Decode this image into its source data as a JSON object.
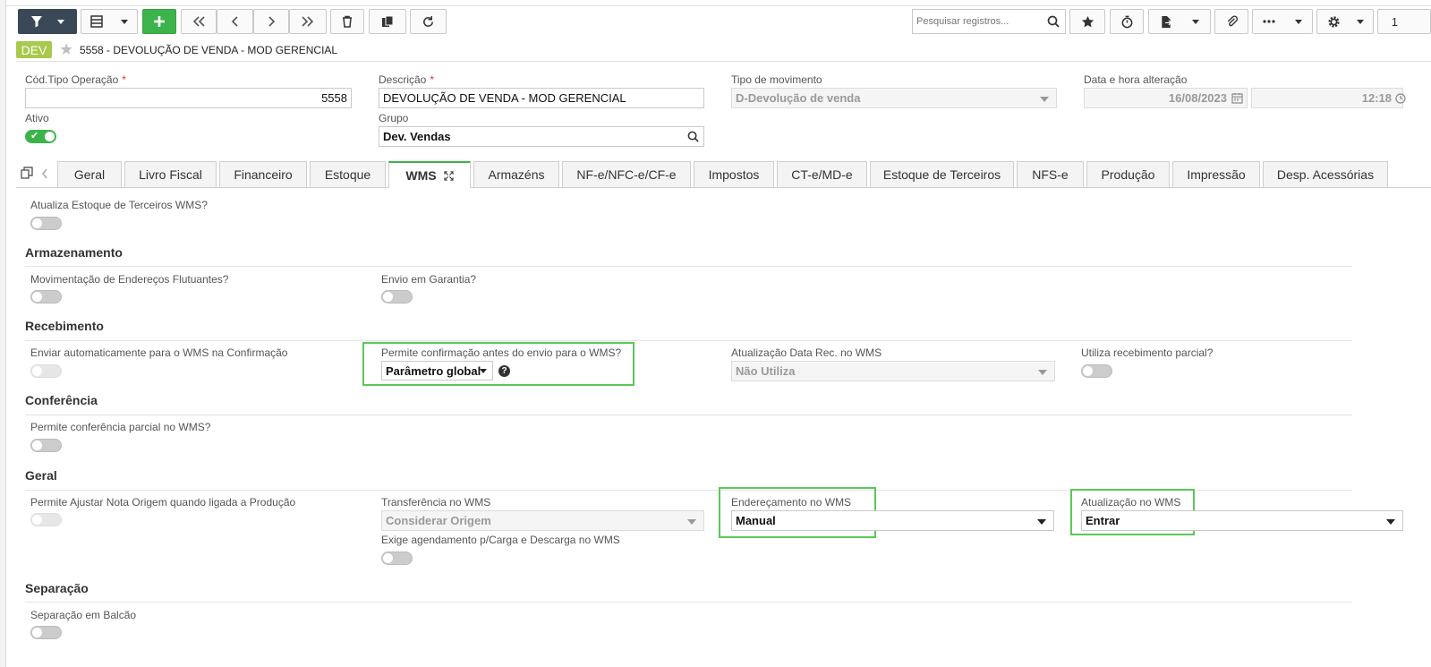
{
  "toolbar": {
    "search_placeholder": "Pesquisar registros...",
    "page_number": "1"
  },
  "header": {
    "badge": "DEV",
    "title": "5558 - DEVOLUÇÃO DE VENDA - MOD GERENCIAL"
  },
  "form": {
    "cod_tipo_operacao": {
      "label": "Cód.Tipo Operação",
      "value": "5558"
    },
    "descricao": {
      "label": "Descrição",
      "value": "DEVOLUÇÃO DE VENDA - MOD GERENCIAL"
    },
    "tipo_movimento": {
      "label": "Tipo de movimento",
      "value": "D-Devolução de venda"
    },
    "data_hora": {
      "label": "Data e hora alteração",
      "date": "16/08/2023",
      "time": "12:18"
    },
    "ativo": {
      "label": "Ativo",
      "on": true
    },
    "grupo": {
      "label": "Grupo",
      "value": "Dev. Vendas"
    }
  },
  "tabs": [
    "Geral",
    "Livro Fiscal",
    "Financeiro",
    "Estoque",
    "WMS",
    "Armazéns",
    "NF-e/NFC-e/CF-e",
    "Impostos",
    "CT-e/MD-e",
    "Estoque de Terceiros",
    "NFS-e",
    "Produção",
    "Impressão",
    "Desp. Acessórias"
  ],
  "active_tab": "WMS",
  "wms": {
    "atualiza_estoque_terceiros": {
      "label": "Atualiza Estoque de Terceiros WMS?",
      "on": false
    },
    "armazenamento": {
      "title": "Armazenamento",
      "mov_enderecos": {
        "label": "Movimentação de Endereços Flutuantes?",
        "on": false
      },
      "envio_garantia": {
        "label": "Envio em Garantia?",
        "on": false
      }
    },
    "recebimento": {
      "title": "Recebimento",
      "enviar_auto": {
        "label": "Enviar automaticamente para o WMS na Confirmação",
        "on": false,
        "disabled": true
      },
      "permite_confirmacao": {
        "label": "Permite confirmação antes do envio para o WMS?",
        "value": "Parâmetro global"
      },
      "atualizacao_data_rec": {
        "label": "Atualização Data Rec. no WMS",
        "value": "Não Utiliza"
      },
      "utiliza_receb_parcial": {
        "label": "Utiliza recebimento parcial?",
        "on": false
      }
    },
    "conferencia": {
      "title": "Conferência",
      "permite_conf_parcial": {
        "label": "Permite conferência parcial no WMS?",
        "on": false
      }
    },
    "geral": {
      "title": "Geral",
      "permite_ajustar": {
        "label": "Permite Ajustar Nota Origem quando ligada a Produção",
        "on": false,
        "disabled": true
      },
      "transferencia": {
        "label": "Transferência no WMS",
        "value": "Considerar Origem"
      },
      "exige_agendamento": {
        "label": "Exige agendamento p/Carga e Descarga no WMS",
        "on": false
      },
      "enderecamento": {
        "label": "Endereçamento no WMS",
        "value": "Manual"
      },
      "atualizacao": {
        "label": "Atualização no WMS",
        "value": "Entrar"
      }
    },
    "separacao": {
      "title": "Separação",
      "separacao_balcao": {
        "label": "Separação em Balcão",
        "on": false
      }
    }
  },
  "colors": {
    "accent": "#3cb44b",
    "highlight": "#5ac85a",
    "badge": "#a8c94b",
    "toolbar_dark": "#3a4757"
  }
}
